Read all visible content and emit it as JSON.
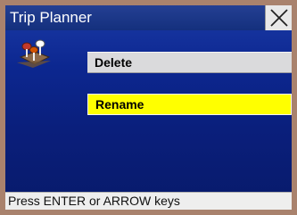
{
  "window": {
    "title": "Trip Planner",
    "close_icon": "close-icon"
  },
  "header_icon": "trip-planner-icon",
  "menu": {
    "items": [
      {
        "label": "Delete",
        "state": "normal"
      },
      {
        "label": "Rename",
        "state": "highlighted"
      }
    ]
  },
  "status": {
    "text": "Press ENTER or ARROW keys"
  },
  "colors": {
    "background": "#0c2790",
    "highlight": "#ffff00",
    "button": "#dadadc",
    "frame": "#a9826d"
  }
}
